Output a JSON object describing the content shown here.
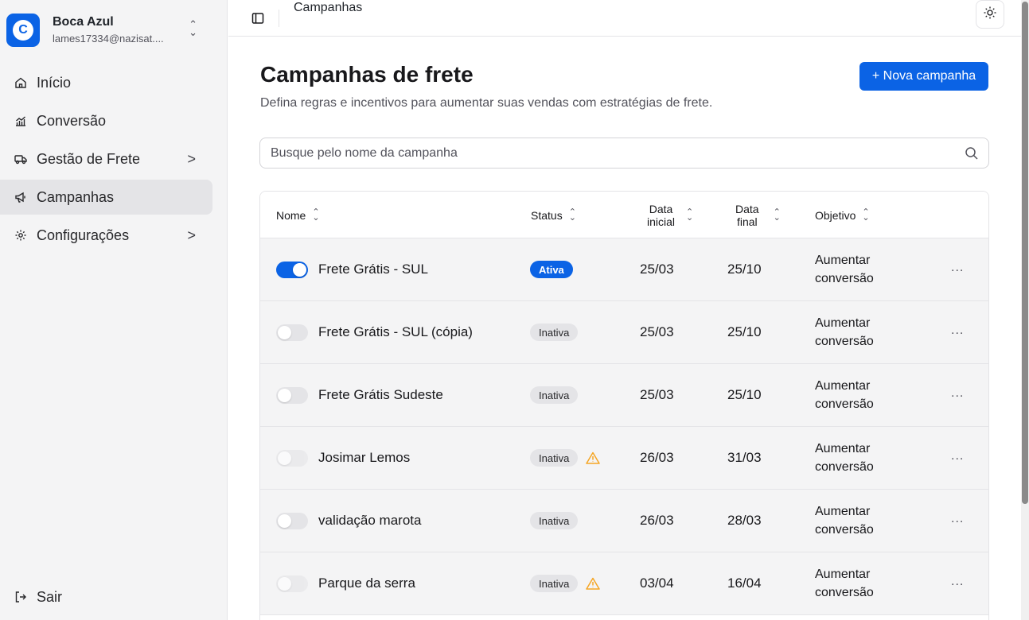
{
  "account": {
    "name": "Boca Azul",
    "email": "lames17334@nazisat....",
    "logo_letter": "C"
  },
  "sidebar": {
    "items": [
      {
        "label": "Início",
        "icon": "home-icon"
      },
      {
        "label": "Conversão",
        "icon": "chart-icon"
      },
      {
        "label": "Gestão de Frete",
        "icon": "truck-icon",
        "chevron": ">"
      },
      {
        "label": "Campanhas",
        "icon": "megaphone-icon",
        "active": true
      },
      {
        "label": "Configurações",
        "icon": "gear-icon",
        "chevron": ">"
      }
    ],
    "logout": "Sair"
  },
  "topbar": {
    "breadcrumb": "Campanhas"
  },
  "main": {
    "title": "Campanhas de frete",
    "subtitle": "Defina regras e incentivos para aumentar suas vendas com estratégias de frete.",
    "new_button": "+ Nova campanha",
    "search_placeholder": "Busque pelo nome da campanha"
  },
  "table": {
    "headers": {
      "name": "Nome",
      "status": "Status",
      "start_line1": "Data",
      "start_line2": "inicial",
      "end_line1": "Data",
      "end_line2": "final",
      "objective": "Objetivo"
    },
    "rows": [
      {
        "enabled": true,
        "name": "Frete Grátis - SUL",
        "status": "Ativa",
        "warning": false,
        "start": "25/03",
        "end": "25/10",
        "objective_l1": "Aumentar",
        "objective_l2": "conversão",
        "more": "..."
      },
      {
        "enabled": false,
        "name": "Frete Grátis - SUL (cópia)",
        "status": "Inativa",
        "warning": false,
        "start": "25/03",
        "end": "25/10",
        "objective_l1": "Aumentar",
        "objective_l2": "conversão",
        "more": "..."
      },
      {
        "enabled": false,
        "name": "Frete Grátis Sudeste",
        "status": "Inativa",
        "warning": false,
        "start": "25/03",
        "end": "25/10",
        "objective_l1": "Aumentar",
        "objective_l2": "conversão",
        "more": "..."
      },
      {
        "enabled": false,
        "name": "Josimar Lemos",
        "status": "Inativa",
        "warning": true,
        "start": "26/03",
        "end": "31/03",
        "objective_l1": "Aumentar",
        "objective_l2": "conversão",
        "more": "..."
      },
      {
        "enabled": false,
        "name": "validação marota",
        "status": "Inativa",
        "warning": false,
        "start": "26/03",
        "end": "28/03",
        "objective_l1": "Aumentar",
        "objective_l2": "conversão",
        "more": "..."
      },
      {
        "enabled": false,
        "name": "Parque da serra",
        "status": "Inativa",
        "warning": true,
        "start": "03/04",
        "end": "16/04",
        "objective_l1": "Aumentar",
        "objective_l2": "conversão",
        "more": "..."
      }
    ]
  },
  "colors": {
    "accent": "#0b63e5",
    "warning": "#f5a524",
    "sidebar_bg": "#f4f4f5"
  }
}
